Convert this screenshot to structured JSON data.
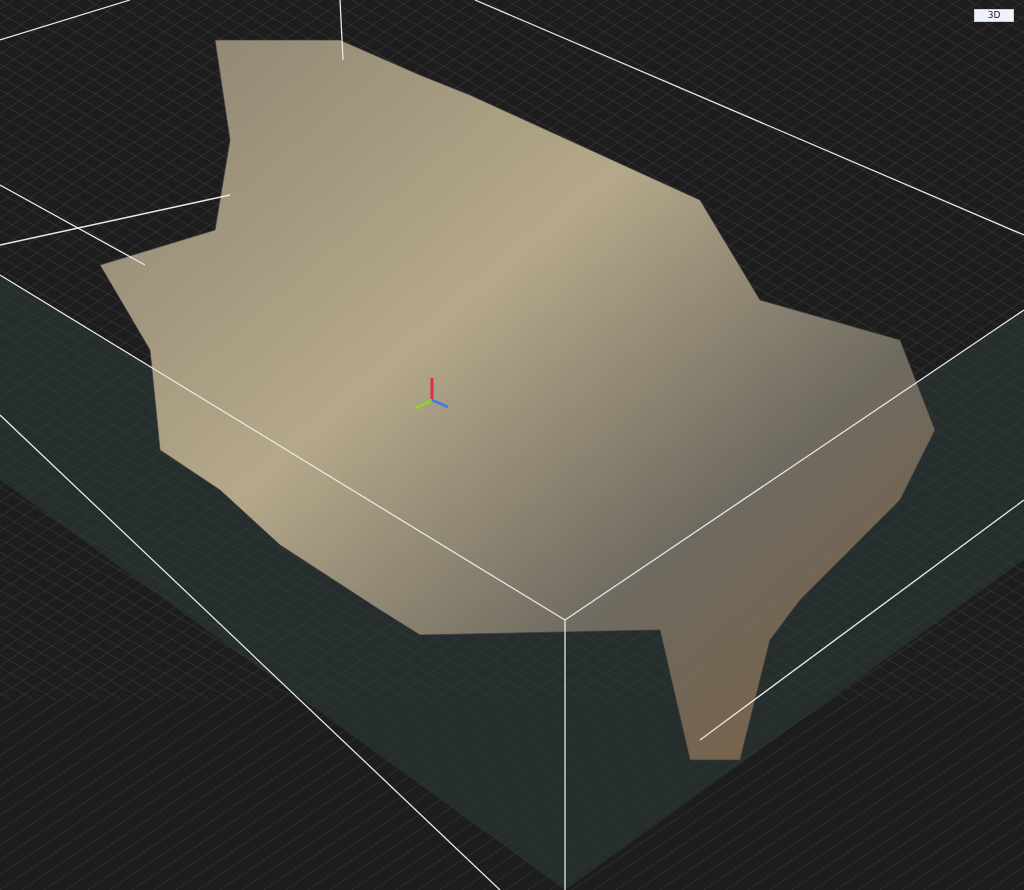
{
  "viewport": {
    "view_button": "3D"
  }
}
